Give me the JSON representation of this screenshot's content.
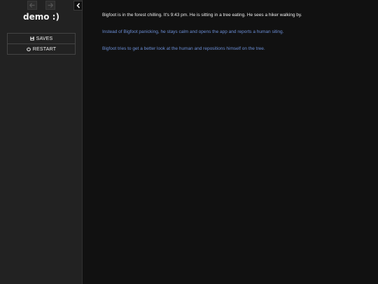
{
  "sidebar": {
    "story_title": "demo :)",
    "history": {
      "back_icon": "arrow-left-icon",
      "forward_icon": "arrow-right-icon"
    },
    "collapse_icon": "chevron-left-icon",
    "menu": [
      {
        "label": "SAVES",
        "icon": "save-icon"
      },
      {
        "label": "RESTART",
        "icon": "power-icon"
      }
    ]
  },
  "passage": {
    "text": "Bigfoot is in the forest chilling. It's 9:43 pm. He is sitting in a tree eating. He sees a hiker walking by.",
    "links": [
      "Instead of Bigfoot panicking, he stays calm and opens the app and reports a human siting.",
      "Bigfoot tries to get a better look at the human and repositions himself on the tree."
    ]
  },
  "colors": {
    "background": "#111111",
    "sidebar": "#222222",
    "text": "#eeeeee",
    "link": "#6b8ed6"
  }
}
